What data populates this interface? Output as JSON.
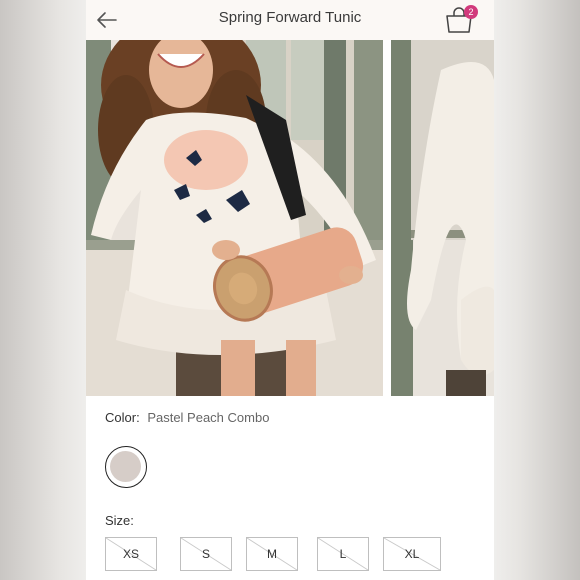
{
  "header": {
    "title": "Spring Forward Tunic",
    "cart_count": "2",
    "back_icon": "back-arrow-icon",
    "cart_icon": "shopping-bag-icon",
    "badge_color": "#d13a7c"
  },
  "gallery": {
    "images": [
      {
        "name": "product-photo-main"
      },
      {
        "name": "product-photo-second"
      }
    ]
  },
  "color": {
    "label": "Color:",
    "value": "Pastel Peach Combo",
    "swatch_color": "#d6cdc8"
  },
  "size": {
    "label": "Size:",
    "options": [
      "XS",
      "S",
      "M",
      "L",
      "XL"
    ]
  }
}
